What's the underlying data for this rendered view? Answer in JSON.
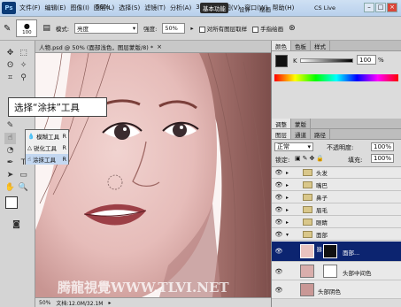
{
  "app": {
    "logo": "Ps",
    "zoom_select": "50%",
    "workspace_active": "基本功能",
    "workspace_links": [
      "设计",
      "绘画"
    ],
    "cslive": "CS Live"
  },
  "menus": [
    "文件(F)",
    "编辑(E)",
    "图像(I)",
    "图层(L)",
    "选择(S)",
    "滤镜(T)",
    "分析(A)",
    "3D(D)",
    "视图(V)",
    "窗口(W)",
    "帮助(H)"
  ],
  "options": {
    "brush_size": "100",
    "mode_label": "模式:",
    "mode_value": "亮度",
    "strength_label": "强度:",
    "strength_value": "50%",
    "sample_all": "对所有图层取样",
    "finger_paint": "手指绘画"
  },
  "document": {
    "tab_title": "人物.psd @ 50% (面部浅色，图层蒙版/8) *",
    "close": "×",
    "zoom": "50%",
    "docinfo": "文档:12.0M/32.1M",
    "watermark": "腾龍視覺WWW.TLVI.NET"
  },
  "callout": "选择“涂抹”工具",
  "flyout": {
    "items": [
      "模糊工具",
      "锐化工具",
      "涂抹工具"
    ],
    "shortcut": "R"
  },
  "color_panel": {
    "tabs": [
      "颜色",
      "色板",
      "样式"
    ],
    "channel": "K",
    "value": "100",
    "unit": "%"
  },
  "adjust_panel": {
    "tabs": [
      "调整",
      "蒙版"
    ]
  },
  "layers_panel": {
    "tabs": [
      "图层",
      "通道",
      "路径"
    ],
    "blend_mode": "正常",
    "opacity_label": "不透明度:",
    "opacity_value": "100%",
    "lock_label": "锁定:",
    "fill_label": "填充:",
    "fill_value": "100%",
    "layers": [
      {
        "name": "头发",
        "type": "group"
      },
      {
        "name": "嘴巴",
        "type": "group"
      },
      {
        "name": "鼻子",
        "type": "group"
      },
      {
        "name": "眉毛",
        "type": "group"
      },
      {
        "name": "眼睛",
        "type": "group"
      },
      {
        "name": "面部",
        "type": "group-open"
      },
      {
        "name": "面部...",
        "type": "layer-mask",
        "selected": true
      },
      {
        "name": "头部中间色",
        "type": "layer-mask"
      },
      {
        "name": "头部阴色",
        "type": "layer"
      }
    ]
  },
  "colors": {
    "accent": "#0b2a6e",
    "skin": "#e9c3c0",
    "selection": "#0c2470"
  }
}
